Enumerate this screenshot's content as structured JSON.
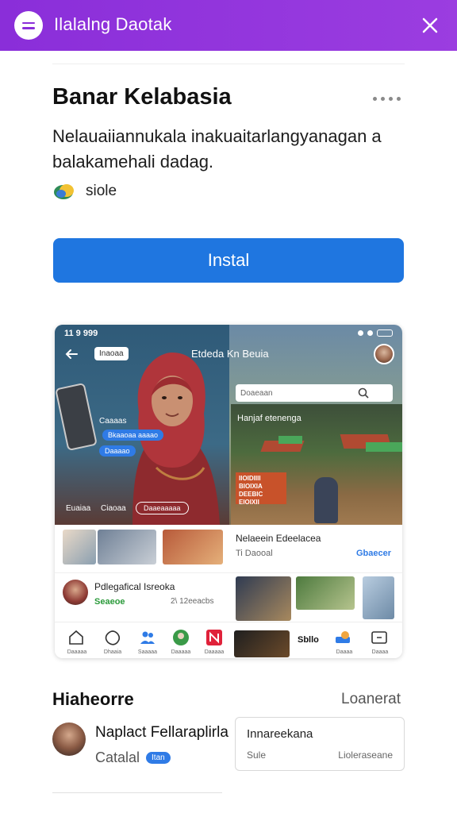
{
  "topbar": {
    "title": "Ilalalng Daotak",
    "bg": "#8a2ed9"
  },
  "app": {
    "name": "Banar Kelabasia",
    "description": "Nelauaiiannukala inakuaitarlangyanagan a balakamehali dadag.",
    "rating_text": "siole",
    "install_label": "Instal",
    "install_color": "#1f76e0"
  },
  "screenshot": {
    "status_time": "11 9 999",
    "back_pill": "Inaoaa",
    "hero_title": "Etdeda Kn Beuia",
    "search_placeholder": "Doaeaan",
    "card_title": "Hanjaf etenenga",
    "left_caption": "Caaaas",
    "chip1": "Bkaaoaa aaaao",
    "chip2": "Daaaao",
    "bottom_left1": "Euaiaa",
    "bottom_left2": "Ciaoaa",
    "outline_chip": "Daaeaaaaa",
    "orange_text": "IIOIDIIII BIOIXIA DEEBIC EIOIXII",
    "row1_title": "Nelaeein Edeelacea",
    "row1_sub": "Ti Daooal",
    "row1_link": "Gbaecer",
    "row2_title": "Pdlegafical Isreoka",
    "row2_green": "Seaeoe",
    "row2_count": "2\\ 12eeacbs",
    "nav_labels": [
      "Daaaaa",
      "Dhaaia",
      "Saaaaa",
      "Daaaaa",
      "Daaaaa"
    ],
    "mid_label": "Sbllo",
    "nav_right": [
      "Daaaa",
      "Daaaa"
    ]
  },
  "reviews": {
    "section_title": "Hiaheorre",
    "section_link": "Loanerat",
    "reviewer_name": "Naplact Fellaraplirla",
    "reviewer_sub": "Catalal",
    "badge": "Itan",
    "info_title": "Innareekana",
    "info_left": "Sule",
    "info_right": "Lioleraseane"
  }
}
